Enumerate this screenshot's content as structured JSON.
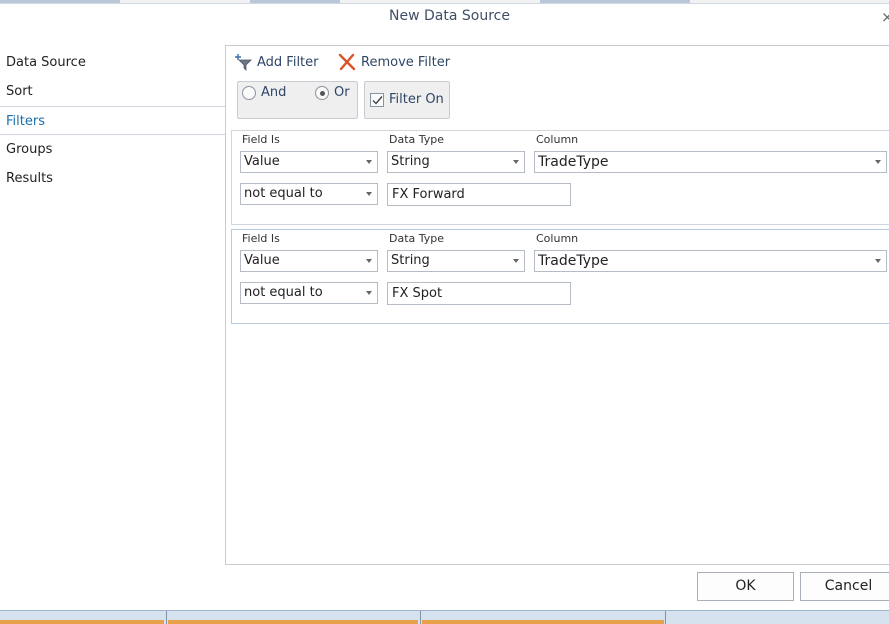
{
  "dialog": {
    "title": "New Data Source",
    "close_glyph": "×"
  },
  "nav": {
    "items": [
      {
        "label": "Data Source"
      },
      {
        "label": "Sort"
      },
      {
        "label": "Filters"
      },
      {
        "label": "Groups"
      },
      {
        "label": "Results"
      }
    ]
  },
  "toolbar": {
    "add_filter": {
      "label": "Add Filter",
      "icon": "add-filter-icon"
    },
    "remove_filter": {
      "label": "Remove Filter",
      "icon": "remove-filter-icon"
    }
  },
  "logic": {
    "and_label": "And",
    "or_label": "Or",
    "selected": "Or",
    "filter_on_label": "Filter On",
    "filter_on_checked": true
  },
  "filter_headers": {
    "field_is": "Field Is",
    "data_type": "Data Type",
    "column": "Column"
  },
  "filters": [
    {
      "field_is": "Value",
      "data_type": "String",
      "column": "TradeType",
      "operator": "not equal to",
      "value": "FX Forward"
    },
    {
      "field_is": "Value",
      "data_type": "String",
      "column": "TradeType",
      "operator": "not equal to",
      "value": "FX Spot"
    }
  ],
  "buttons": {
    "ok": "OK",
    "cancel": "Cancel"
  },
  "colors": {
    "accent": "#1a6fae",
    "toolbar_text": "#2e4666",
    "remove_icon": "#d9542b",
    "taskbar_orange": "#e8a04b"
  }
}
